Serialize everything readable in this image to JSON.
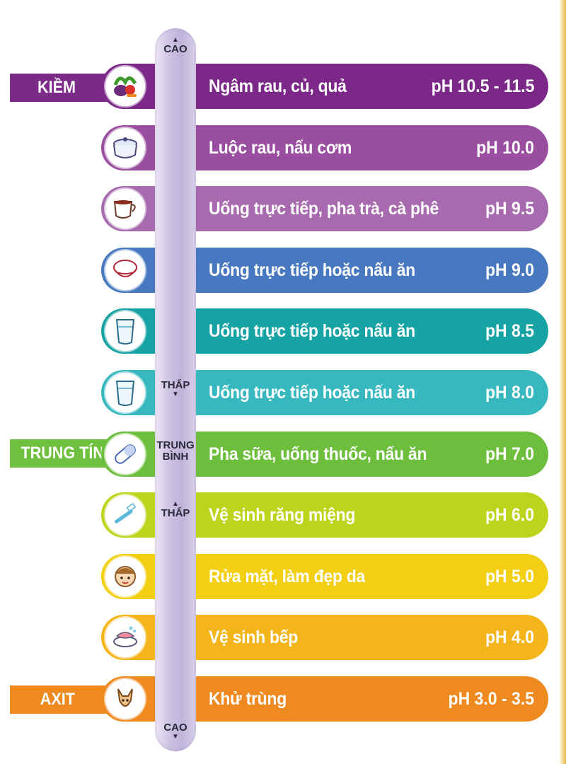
{
  "categories": {
    "alkaline": {
      "label": "KIỀM",
      "color": "#7b2a88"
    },
    "neutral": {
      "label": "TRUNG TÍNH",
      "color": "#6fc03e"
    },
    "acid": {
      "label": "AXIT",
      "color": "#ee8a1f"
    }
  },
  "scale": {
    "top_high": "CAO",
    "alk_low": "THẤP",
    "neutral_line1": "TRUNG",
    "neutral_line2": "BÌNH",
    "acid_low": "THẤP",
    "bottom_high": "CAO",
    "up_arrow": "▲",
    "down_arrow": "▼"
  },
  "rows": [
    {
      "label": "Ngâm rau, củ, quả",
      "value": "pH 10.5 - 11.5",
      "color": "#7c2889",
      "icon": "vegetables-icon"
    },
    {
      "label": "Luộc rau, nấu cơm",
      "value": "pH 10.0",
      "color": "#9a4ea0",
      "icon": "cooking-pot-icon"
    },
    {
      "label": "Uống trực tiếp, pha trà, cà phê",
      "value": "pH 9.5",
      "color": "#a86aae",
      "icon": "coffee-cup-icon"
    },
    {
      "label": "Uống trực tiếp hoặc nấu ăn",
      "value": "pH 9.0",
      "color": "#4778c0",
      "icon": "rice-bowl-icon"
    },
    {
      "label": "Uống trực tiếp hoặc nấu ăn",
      "value": "pH 8.5",
      "color": "#17a2a4",
      "icon": "water-glass-icon"
    },
    {
      "label": "Uống trực tiếp hoặc nấu ăn",
      "value": "pH 8.0",
      "color": "#36b8be",
      "icon": "water-glass-icon"
    },
    {
      "label": "Pha sữa, uống thuốc, nấu ăn",
      "value": "pH 7.0",
      "color": "#6cbe3c",
      "icon": "pill-icon"
    },
    {
      "label": "Vệ sinh răng miệng",
      "value": "pH 6.0",
      "color": "#bcd41c",
      "icon": "toothbrush-icon"
    },
    {
      "label": "Rửa mặt, làm đẹp da",
      "value": "pH 5.0",
      "color": "#f2cf12",
      "icon": "face-wash-icon"
    },
    {
      "label": "Vệ sinh bếp",
      "value": "pH 4.0",
      "color": "#f3b51a",
      "icon": "dish-sponge-icon"
    },
    {
      "label": "Khử trùng",
      "value": "pH 3.0 - 3.5",
      "color": "#ee8a1f",
      "icon": "germ-icon"
    }
  ]
}
